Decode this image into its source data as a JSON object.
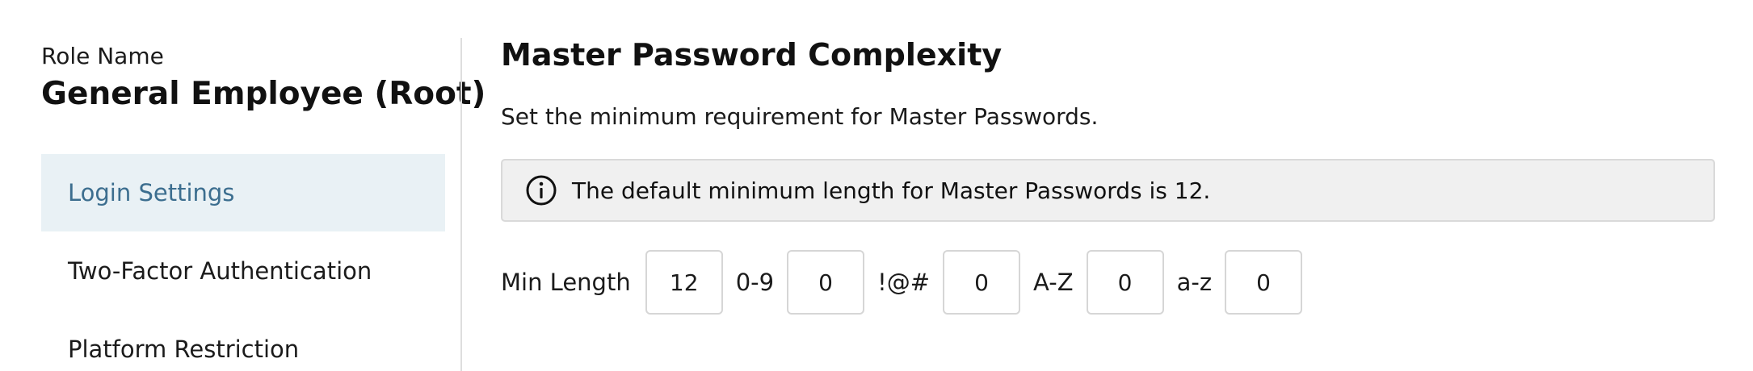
{
  "sidebar": {
    "role_label": "Role Name",
    "role_name": "General Employee (Root)",
    "items": [
      {
        "label": "Login Settings",
        "active": true
      },
      {
        "label": "Two-Factor Authentication",
        "active": false
      },
      {
        "label": "Platform Restriction",
        "active": false
      }
    ]
  },
  "main": {
    "title": "Master Password Complexity",
    "subtitle": "Set the minimum requirement for Master Passwords.",
    "info": {
      "icon": "info-icon",
      "text": "The default minimum length for Master Passwords is 12."
    },
    "complexity": {
      "min_length_label": "Min Length",
      "min_length_value": "12",
      "digits_label": "0-9",
      "digits_value": "0",
      "symbols_label": "!@#",
      "symbols_value": "0",
      "upper_label": "A-Z",
      "upper_value": "0",
      "lower_label": "a-z",
      "lower_value": "0"
    }
  },
  "colors": {
    "active_bg": "#e9f1f5",
    "active_text": "#3c6e8f",
    "info_bg": "#f0f0f0",
    "border": "#d6d6d6"
  }
}
